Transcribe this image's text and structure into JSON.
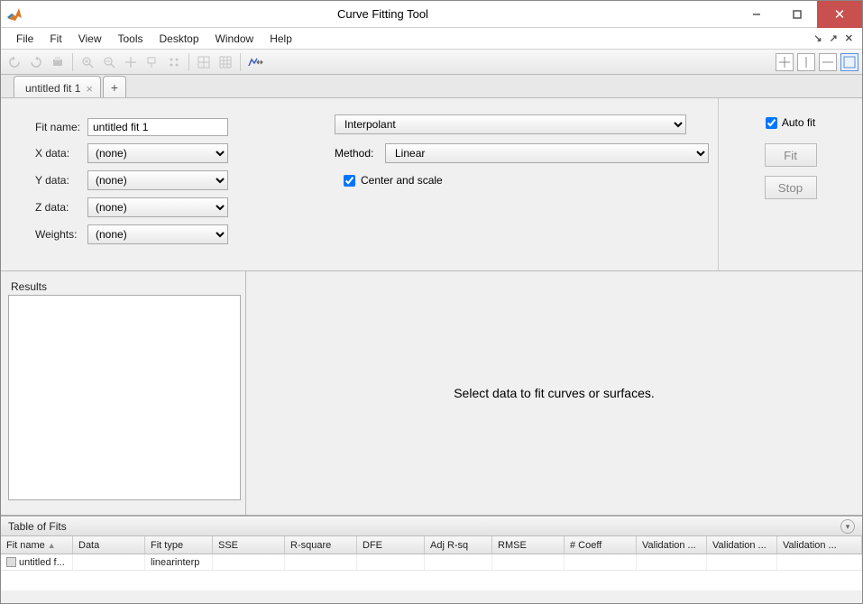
{
  "titlebar": {
    "title": "Curve Fitting Tool"
  },
  "menu": {
    "items": [
      "File",
      "Fit",
      "View",
      "Tools",
      "Desktop",
      "Window",
      "Help"
    ]
  },
  "tabs": {
    "active": "untitled fit 1"
  },
  "config": {
    "fit_name_label": "Fit name:",
    "fit_name": "untitled fit 1",
    "x_label": "X data:",
    "x_value": "(none)",
    "y_label": "Y data:",
    "y_value": "(none)",
    "z_label": "Z data:",
    "z_value": "(none)",
    "w_label": "Weights:",
    "w_value": "(none)",
    "fit_type": "Interpolant",
    "method_label": "Method:",
    "method": "Linear",
    "center_scale_label": "Center and scale"
  },
  "right": {
    "auto_fit_label": "Auto fit",
    "fit_btn": "Fit",
    "stop_btn": "Stop"
  },
  "results": {
    "label": "Results"
  },
  "plot": {
    "message": "Select data to fit curves or surfaces."
  },
  "tof": {
    "title": "Table of Fits",
    "columns": [
      "Fit name",
      "Data",
      "Fit type",
      "SSE",
      "R-square",
      "DFE",
      "Adj R-sq",
      "RMSE",
      "# Coeff",
      "Validation ...",
      "Validation ...",
      "Validation ..."
    ],
    "row": {
      "fit_name": "untitled f...",
      "fit_type": "linearinterp"
    }
  }
}
